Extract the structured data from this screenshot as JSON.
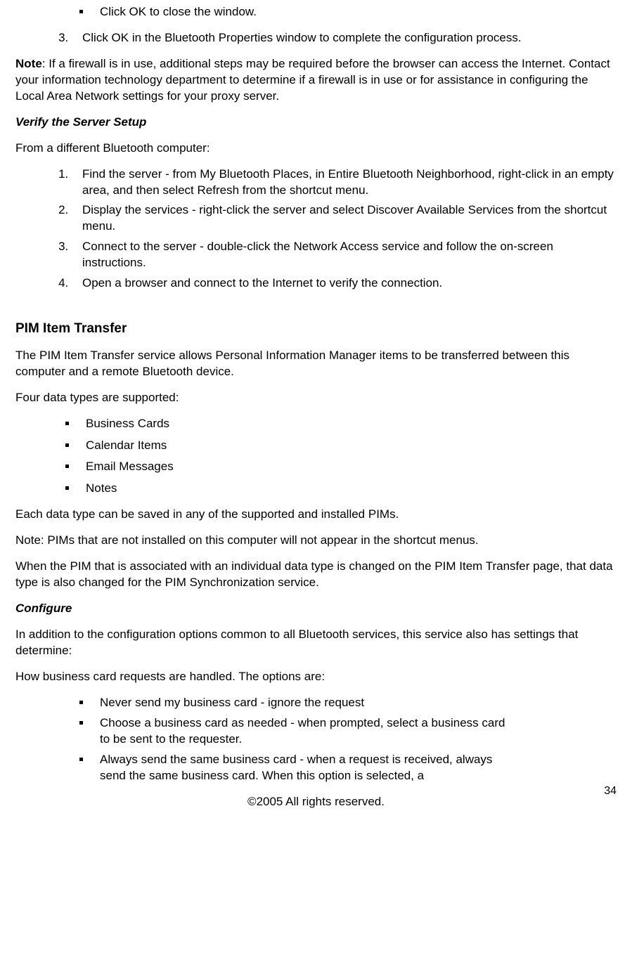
{
  "bullet_top": "Click OK to close the window.",
  "ol_top_start": 3,
  "ol_top_item": "Click OK in the Bluetooth Properties window to complete the configuration process.",
  "note_label": "Note",
  "note_text": ": If a firewall is in use, additional steps may be required before the browser can access the Internet. Contact your information technology department to determine if a firewall is in use or for assistance in configuring the Local Area Network settings for your proxy server.",
  "verify_heading": "Verify the Server Setup",
  "verify_intro": "From a different Bluetooth computer:",
  "verify_steps": [
    "Find the server - from My Bluetooth Places, in Entire Bluetooth Neighborhood, right-click in an empty area, and then select Refresh from the shortcut menu.",
    "Display the services - right-click the server and select Discover Available Services from the shortcut menu.",
    "Connect to the server - double-click the Network Access service and follow the on-screen instructions.",
    "Open a browser and connect to the Internet to verify the connection."
  ],
  "pim_heading": "PIM Item Transfer",
  "pim_intro": "The PIM Item Transfer service allows Personal Information Manager items to be transferred between this computer and a remote Bluetooth device.",
  "pim_data_intro": "Four data types are supported:",
  "pim_data_types": [
    "Business Cards",
    "Calendar Items",
    "Email Messages",
    "Notes"
  ],
  "pim_para1": "Each data type can be saved in any of the supported and installed PIMs.",
  "pim_para2": "Note: PIMs that are not installed on this computer will not appear in the shortcut menus.",
  "pim_para3": "When the PIM that is associated with an individual data type is changed on the PIM Item Transfer page, that data type is also changed for the PIM Synchronization service.",
  "configure_heading": "Configure",
  "configure_intro": "In addition to the configuration options common to all Bluetooth services, this service also has settings that determine:",
  "bc_intro": "How business card requests are handled. The options are:",
  "bc_options": [
    "Never send my business card - ignore the request",
    "Choose a business card as needed - when prompted, select a business card to be sent to the requester.",
    "Always send the same business card - when a request is received, always send the same business card. When this option is selected, a"
  ],
  "footer_text": "©2005 All rights reserved.",
  "page_number": "34"
}
